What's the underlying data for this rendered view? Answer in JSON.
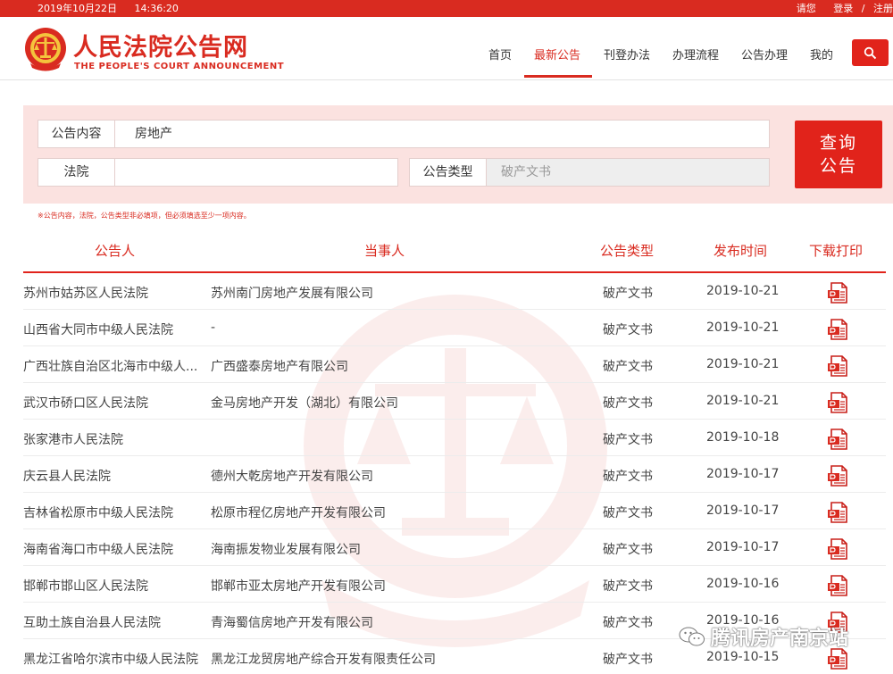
{
  "topbar": {
    "date": "2019年10月22日",
    "time": "14:36:20",
    "greeting": "请您",
    "login": "登录",
    "sep": "/",
    "register": "注册"
  },
  "header": {
    "logo_cn": "人民法院公告网",
    "logo_en": "THE PEOPLE'S COURT ANNOUNCEMENT"
  },
  "nav": [
    {
      "label": "首页",
      "active": false
    },
    {
      "label": "最新公告",
      "active": true
    },
    {
      "label": "刊登办法",
      "active": false
    },
    {
      "label": "办理流程",
      "active": false
    },
    {
      "label": "公告办理",
      "active": false
    },
    {
      "label": "我的",
      "active": false
    }
  ],
  "search": {
    "content_label": "公告内容",
    "content_value": "房地产",
    "court_label": "法院",
    "court_value": "",
    "type_label": "公告类型",
    "type_value": "破产文书",
    "button_line1": "查询",
    "button_line2": "公告",
    "note": "※公告内容，法院，公告类型非必填项，但必须填选至少一项内容。"
  },
  "table": {
    "headers": {
      "court": "公告人",
      "party": "当事人",
      "type": "公告类型",
      "date": "发布时间",
      "download": "下载打印"
    },
    "rows": [
      {
        "court": "苏州市姑苏区人民法院",
        "party": "苏州南门房地产发展有限公司",
        "type": "破产文书",
        "date": "2019-10-21"
      },
      {
        "court": "山西省大同市中级人民法院",
        "party": "-",
        "type": "破产文书",
        "date": "2019-10-21"
      },
      {
        "court": "广西壮族自治区北海市中级人...",
        "party": "广西盛泰房地产有限公司",
        "type": "破产文书",
        "date": "2019-10-21"
      },
      {
        "court": "武汉市硚口区人民法院",
        "party": "金马房地产开发（湖北）有限公司",
        "type": "破产文书",
        "date": "2019-10-21"
      },
      {
        "court": "张家港市人民法院",
        "party": "",
        "type": "破产文书",
        "date": "2019-10-18"
      },
      {
        "court": "庆云县人民法院",
        "party": "德州大乾房地产开发有限公司",
        "type": "破产文书",
        "date": "2019-10-17"
      },
      {
        "court": "吉林省松原市中级人民法院",
        "party": "松原市程亿房地产开发有限公司",
        "type": "破产文书",
        "date": "2019-10-17"
      },
      {
        "court": "海南省海口市中级人民法院",
        "party": "海南振发物业发展有限公司",
        "type": "破产文书",
        "date": "2019-10-17"
      },
      {
        "court": "邯郸市邯山区人民法院",
        "party": "邯郸市亚太房地产开发有限公司",
        "type": "破产文书",
        "date": "2019-10-16"
      },
      {
        "court": "互助土族自治县人民法院",
        "party": "青海蜀信房地产开发有限公司",
        "type": "破产文书",
        "date": "2019-10-16"
      },
      {
        "court": "黑龙江省哈尔滨市中级人民法院",
        "party": "黑龙江龙贸房地产综合开发有限责任公司",
        "type": "破产文书",
        "date": "2019-10-15"
      }
    ]
  },
  "watermark_text": "腾讯房产南京站",
  "colors": {
    "brand_red": "#d92b20",
    "button_red": "#e1231b",
    "panel_bg": "#fbe2e0"
  }
}
